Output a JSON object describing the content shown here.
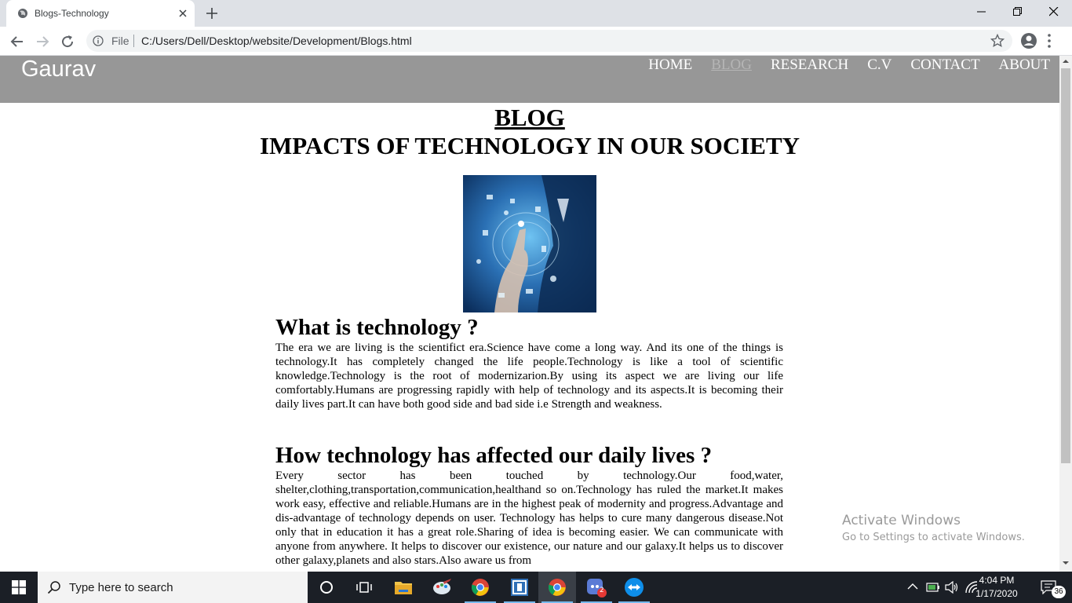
{
  "browser": {
    "tab_title": "Blogs-Technology",
    "address_scheme": "File",
    "address_url": "C:/Users/Dell/Desktop/website/Development/Blogs.html"
  },
  "site": {
    "brand": "Gaurav",
    "nav": [
      "HOME",
      "BLOG",
      "RESEARCH",
      "C.V",
      "CONTACT",
      "ABOUT"
    ],
    "active_nav": "BLOG",
    "blog_title": "BLOG",
    "subtitle": "IMPACTS OF TECHNOLOGY IN OUR SOCIETY",
    "sections": [
      {
        "heading": "What is technology ?",
        "body": "The era we are living is the scientifict era.Science have come a long way. And its one of the things is technology.It has completely changed the life people.Technology is like a tool of scientific knowledge.Technology is the root of modernizarion.By using its aspect we are living our life comfortably.Humans are progressing rapidly with help of technology and its aspects.It is becoming their daily lives part.It can have both good side and bad side i.e Strength and weakness."
      },
      {
        "heading": "How technology has affected our daily lives ?",
        "body": "Every sector has been touched by technology.Our food,water, shelter,clothing,transportation,communication,healthand so on.Technology has ruled the market.It makes work easy, effective and reliable.Humans are in the highest peak of modernity and progress.Advantage and dis-advantage of technology depends on user. Technology has helps to cure many dangerous disease.Not only that in education it has a great role.Sharing of idea is becoming easier. We can communicate with anyone from anywhere. It helps to discover our existence, our nature and our galaxy.It helps us to discover other galaxy,planets and also stars.Also aware us from"
      }
    ]
  },
  "watermark": {
    "line1": "Activate Windows",
    "line2": "Go to Settings to activate Windows."
  },
  "taskbar": {
    "search_placeholder": "Type here to search",
    "time": "4:04 PM",
    "date": "1/17/2020",
    "notification_count": "36",
    "discord_badge": "2"
  },
  "colors": {
    "header_bg": "#979797",
    "taskbar_bg": "#1b1f26",
    "tabstrip_bg": "#dee1e6"
  }
}
